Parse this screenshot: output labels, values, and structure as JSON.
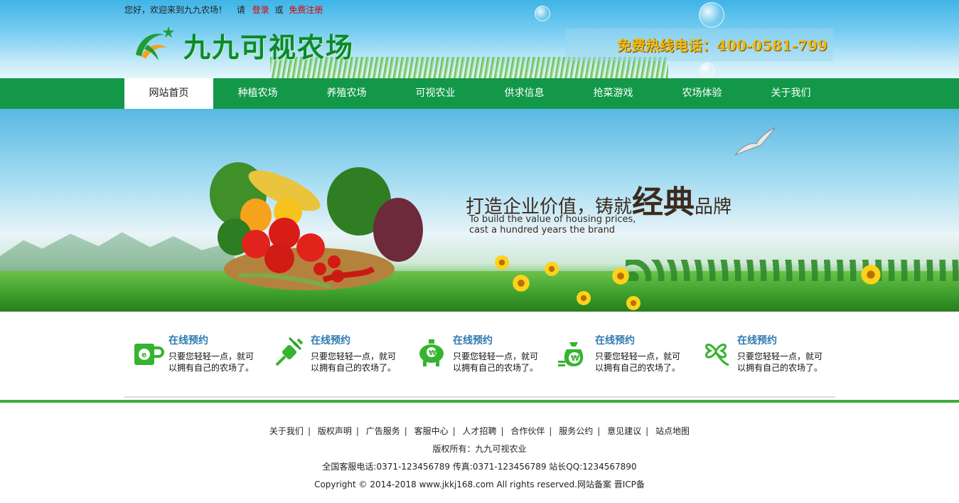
{
  "header": {
    "welcome_text": "您好，欢迎来到九九农场！",
    "please_text": "请",
    "login_link": "登录",
    "or_text": "或",
    "register_link": "免费注册",
    "site_name": "九九可视农场",
    "hotline_label": "免费热线电话：",
    "hotline_number": "400-0581-799"
  },
  "nav": {
    "items": [
      {
        "label": "网站首页",
        "active": true
      },
      {
        "label": "种植农场"
      },
      {
        "label": "养殖农场"
      },
      {
        "label": "可视农业"
      },
      {
        "label": "供求信息"
      },
      {
        "label": "抢菜游戏"
      },
      {
        "label": "农场体验"
      },
      {
        "label": "关于我们"
      }
    ]
  },
  "banner": {
    "slogan_pre": "打造企业价值，铸就",
    "slogan_big": "经典",
    "slogan_post": "品牌",
    "slogan_en_line1": "To build the value of housing prices,",
    "slogan_en_line2": "cast a hundred years the brand"
  },
  "features": [
    {
      "icon": "cup-icon",
      "title": "在线预约",
      "desc": "只要您轻轻一点，就可以拥有自己的农场了。"
    },
    {
      "icon": "plug-icon",
      "title": "在线预约",
      "desc": "只要您轻轻一点，就可以拥有自己的农场了。"
    },
    {
      "icon": "piggy-bank-icon",
      "title": "在线预约",
      "desc": "只要您轻轻一点，就可以拥有自己的农场了。"
    },
    {
      "icon": "money-bag-icon",
      "title": "在线预约",
      "desc": "只要您轻轻一点，就可以拥有自己的农场了。"
    },
    {
      "icon": "clover-icon",
      "title": "在线预约",
      "desc": "只要您轻轻一点，就可以拥有自己的农场了。"
    }
  ],
  "footer": {
    "links": [
      "关于我们",
      "版权声明",
      "广告服务",
      "客服中心",
      "人才招聘",
      "合作伙伴",
      "服务公约",
      "意见建议",
      "站点地图"
    ],
    "copyright_owner": "版权所有：九九可视农业",
    "contact": "全国客服电话:0371-123456789 传真:0371-123456789 站长QQ:1234567890",
    "copyright": "Copyright © 2014-2018 www.jkkj168.com All rights reserved.网站备案 晋ICP备"
  },
  "colors": {
    "nav_green": "#129848",
    "accent_red": "#e00000",
    "hotline_gold": "#f1b90f",
    "feature_title_blue": "#2e7ab0",
    "divider_green": "#3cae3c"
  }
}
